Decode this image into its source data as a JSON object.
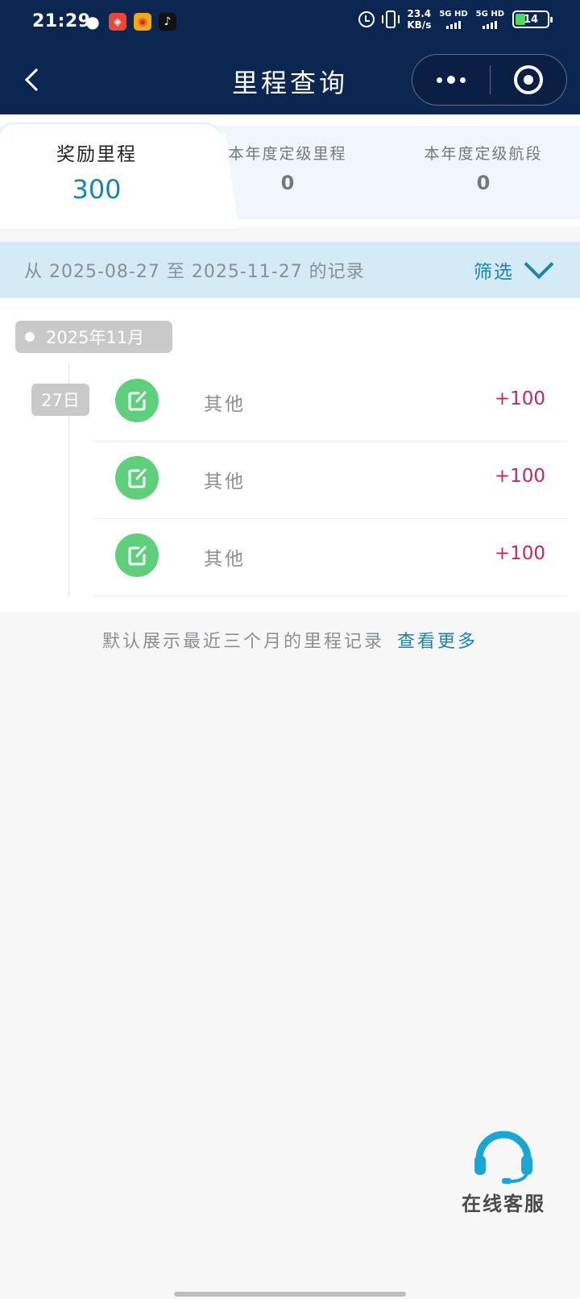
{
  "status_bar": {
    "time": "21:29",
    "net_speed_value": "23.4",
    "net_speed_unit": "KB/s",
    "signal_1": "5G HD",
    "signal_2": "5G HD",
    "battery": "14"
  },
  "nav": {
    "title": "里程查询"
  },
  "tabs": [
    {
      "label": "奖励里程",
      "value": "300"
    },
    {
      "label": "本年度定级里程",
      "value": "0"
    },
    {
      "label": "本年度定级航段",
      "value": "0"
    }
  ],
  "filter": {
    "range_text": "从 2025-08-27 至 2025-11-27 的记录",
    "button_label": "筛选"
  },
  "records": {
    "month": "2025年11月",
    "day": "27日",
    "items": [
      {
        "title": "其他",
        "amount": "+100"
      },
      {
        "title": "其他",
        "amount": "+100"
      },
      {
        "title": "其他",
        "amount": "+100"
      }
    ]
  },
  "footer_note": {
    "text": "默认展示最近三个月的里程记录",
    "link": "查看更多"
  },
  "customer_service": {
    "label": "在线客服"
  },
  "colors": {
    "nav_bg": "#0b2650",
    "accent": "#1b84ad",
    "amount": "#c12a5a",
    "record_icon": "#5fcf7b",
    "filter_bg": "#d4ebf5"
  }
}
